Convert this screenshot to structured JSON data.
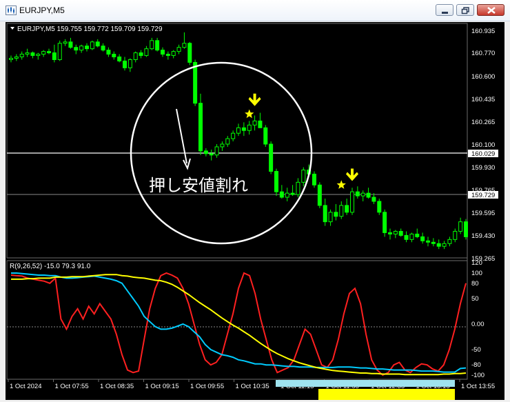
{
  "window": {
    "title": "EURJPY,M5",
    "buttons": [
      "minimize",
      "maximize",
      "close"
    ]
  },
  "chart": {
    "header": "EURJPY,M5  159.755 159.772 159.709 159.729",
    "colors": {
      "background": "#000000",
      "candle": "#00ff00",
      "axis_text": "#ffffff",
      "price_line": "#ffffff",
      "annotation_circle": "#ffffff",
      "arrow": "#ffff00",
      "star": "#ffff00"
    },
    "price_labels": [
      "160.935",
      "160.770",
      "160.600",
      "160.435",
      "160.265",
      "160.100",
      "159.930",
      "159.765",
      "159.595",
      "159.430",
      "159.265"
    ],
    "highlight_labels": [
      "160.029",
      "159.729"
    ],
    "time_labels": [
      "1 Oct 2024",
      "1 Oct 07:55",
      "1 Oct 08:35",
      "1 Oct 09:15",
      "1 Oct 09:55",
      "1 Oct 10:35",
      "1 Oct 11:15",
      "1 Oct 11:55",
      "1 Oct 12:35",
      "1 Oct 13:15",
      "1 Oct 13:55"
    ],
    "annotation": "押し安値割れ"
  },
  "chart_data": [
    {
      "type": "candlestick",
      "symbol": "EURJPY",
      "timeframe": "M5",
      "ylim": [
        159.2,
        161.0
      ],
      "last_price": 159.729,
      "horizontal_line": 160.029,
      "candles": [
        [
          160.72,
          160.75,
          160.7,
          160.73
        ],
        [
          160.73,
          160.76,
          160.71,
          160.74
        ],
        [
          160.74,
          160.78,
          160.72,
          160.76
        ],
        [
          160.76,
          160.8,
          160.74,
          160.77
        ],
        [
          160.77,
          160.78,
          160.73,
          160.75
        ],
        [
          160.75,
          160.77,
          160.72,
          160.76
        ],
        [
          160.76,
          160.79,
          160.74,
          160.78
        ],
        [
          160.78,
          160.8,
          160.76,
          160.77
        ],
        [
          160.77,
          160.83,
          160.7,
          160.72
        ],
        [
          160.72,
          160.86,
          160.71,
          160.84
        ],
        [
          160.84,
          160.87,
          160.82,
          160.85
        ],
        [
          160.85,
          160.88,
          160.8,
          160.81
        ],
        [
          160.81,
          160.83,
          160.76,
          160.79
        ],
        [
          160.79,
          160.83,
          160.77,
          160.82
        ],
        [
          160.82,
          160.84,
          160.78,
          160.8
        ],
        [
          160.8,
          160.86,
          160.79,
          160.85
        ],
        [
          160.85,
          160.87,
          160.81,
          160.82
        ],
        [
          160.82,
          160.84,
          160.78,
          160.79
        ],
        [
          160.79,
          160.81,
          160.74,
          160.76
        ],
        [
          160.76,
          160.78,
          160.72,
          160.74
        ],
        [
          160.74,
          160.76,
          160.7,
          160.71
        ],
        [
          160.71,
          160.74,
          160.64,
          160.66
        ],
        [
          160.66,
          160.73,
          160.63,
          160.72
        ],
        [
          160.72,
          160.78,
          160.7,
          160.77
        ],
        [
          160.77,
          160.79,
          160.73,
          160.75
        ],
        [
          160.75,
          160.82,
          160.74,
          160.8
        ],
        [
          160.8,
          160.88,
          160.79,
          160.86
        ],
        [
          160.86,
          160.88,
          160.78,
          160.79
        ],
        [
          160.79,
          160.81,
          160.74,
          160.76
        ],
        [
          160.76,
          160.78,
          160.72,
          160.75
        ],
        [
          160.75,
          160.79,
          160.73,
          160.78
        ],
        [
          160.78,
          160.83,
          160.76,
          160.81
        ],
        [
          160.81,
          160.92,
          160.8,
          160.84
        ],
        [
          160.84,
          160.85,
          160.68,
          160.7
        ],
        [
          160.7,
          160.72,
          160.38,
          160.4
        ],
        [
          160.4,
          160.47,
          160.02,
          160.05
        ],
        [
          160.05,
          160.07,
          160.01,
          160.03
        ],
        [
          160.03,
          160.06,
          159.98,
          160.02
        ],
        [
          160.02,
          160.1,
          160.0,
          160.08
        ],
        [
          160.08,
          160.12,
          160.05,
          160.1
        ],
        [
          160.1,
          160.16,
          160.08,
          160.14
        ],
        [
          160.14,
          160.2,
          160.12,
          160.18
        ],
        [
          160.18,
          160.25,
          160.16,
          160.22
        ],
        [
          160.22,
          160.26,
          160.16,
          160.2
        ],
        [
          160.2,
          160.27,
          160.17,
          160.24
        ],
        [
          160.24,
          160.31,
          160.2,
          160.27
        ],
        [
          160.27,
          160.33,
          160.22,
          160.22
        ],
        [
          160.22,
          160.24,
          160.08,
          160.1
        ],
        [
          160.1,
          160.12,
          159.88,
          159.9
        ],
        [
          159.9,
          159.92,
          159.72,
          159.75
        ],
        [
          159.75,
          159.8,
          159.7,
          159.71
        ],
        [
          159.71,
          159.78,
          159.68,
          159.74
        ],
        [
          159.74,
          159.8,
          159.72,
          159.73
        ],
        [
          159.73,
          159.85,
          159.71,
          159.82
        ],
        [
          159.82,
          159.93,
          159.79,
          159.91
        ],
        [
          159.91,
          159.95,
          159.86,
          159.88
        ],
        [
          159.88,
          159.9,
          159.78,
          159.8
        ],
        [
          159.8,
          159.82,
          159.63,
          159.65
        ],
        [
          159.65,
          159.7,
          159.5,
          159.53
        ],
        [
          159.53,
          159.62,
          159.5,
          159.6
        ],
        [
          159.6,
          159.66,
          159.54,
          159.57
        ],
        [
          159.57,
          159.68,
          159.55,
          159.65
        ],
        [
          159.65,
          159.7,
          159.58,
          159.6
        ],
        [
          159.6,
          159.78,
          159.58,
          159.75
        ],
        [
          159.75,
          159.79,
          159.7,
          159.72
        ],
        [
          159.72,
          159.76,
          159.68,
          159.74
        ],
        [
          159.74,
          159.78,
          159.7,
          159.71
        ],
        [
          159.71,
          159.74,
          159.66,
          159.68
        ],
        [
          159.68,
          159.7,
          159.58,
          159.6
        ],
        [
          159.6,
          159.62,
          159.42,
          159.45
        ],
        [
          159.45,
          159.48,
          159.4,
          159.44
        ],
        [
          159.44,
          159.47,
          159.41,
          159.46
        ],
        [
          159.46,
          159.48,
          159.42,
          159.43
        ],
        [
          159.43,
          159.46,
          159.38,
          159.4
        ],
        [
          159.4,
          159.45,
          159.38,
          159.44
        ],
        [
          159.44,
          159.48,
          159.41,
          159.42
        ],
        [
          159.42,
          159.45,
          159.37,
          159.39
        ],
        [
          159.39,
          159.42,
          159.35,
          159.38
        ],
        [
          159.38,
          159.41,
          159.35,
          159.37
        ],
        [
          159.37,
          159.4,
          159.33,
          159.35
        ],
        [
          159.35,
          159.39,
          159.33,
          159.37
        ],
        [
          159.37,
          159.42,
          159.35,
          159.4
        ],
        [
          159.4,
          159.48,
          159.38,
          159.46
        ],
        [
          159.46,
          159.56,
          159.44,
          159.53
        ],
        [
          159.53,
          159.55,
          159.4,
          159.42
        ]
      ],
      "markers": [
        {
          "type": "arrow-down",
          "candle": 45,
          "price": 160.42
        },
        {
          "type": "star",
          "candle": 44,
          "price": 160.32
        },
        {
          "type": "arrow-down",
          "candle": 63,
          "price": 159.87
        },
        {
          "type": "star",
          "candle": 61,
          "price": 159.8
        }
      ]
    },
    {
      "type": "line",
      "title": "R(9,26,52) -15.0 79.3 91.0",
      "ylim": [
        -110,
        120
      ],
      "yticks": [
        120,
        100,
        80,
        50,
        0.0,
        -50,
        -80,
        -100
      ],
      "series": [
        {
          "color": "#ff2020",
          "values": [
            96,
            95,
            94,
            90,
            88,
            86,
            84,
            80,
            90,
            10,
            -10,
            15,
            30,
            10,
            35,
            20,
            40,
            25,
            10,
            -20,
            -60,
            -90,
            -95,
            -92,
            -30,
            30,
            70,
            95,
            100,
            96,
            90,
            70,
            40,
            0,
            -40,
            -70,
            -80,
            -75,
            -60,
            -20,
            20,
            70,
            100,
            95,
            60,
            10,
            -30,
            -70,
            -95,
            -90,
            -85,
            -70,
            -40,
            -10,
            -20,
            -50,
            -80,
            -85,
            -70,
            -30,
            20,
            60,
            70,
            40,
            -20,
            -70,
            -90,
            -100,
            -95,
            -80,
            -75,
            -90,
            -95,
            -85,
            -78,
            -80,
            -88,
            -92,
            -80,
            -50,
            -10,
            40,
            80
          ]
        },
        {
          "color": "#00ccff",
          "values": [
            100,
            100,
            99,
            98,
            97,
            96,
            96,
            95,
            95,
            92,
            90,
            90,
            91,
            92,
            93,
            94,
            92,
            90,
            88,
            85,
            80,
            65,
            50,
            35,
            15,
            5,
            -5,
            -10,
            -10,
            -8,
            -4,
            0,
            -5,
            -15,
            -25,
            -40,
            -50,
            -55,
            -60,
            -62,
            -65,
            -70,
            -72,
            -75,
            -78,
            -78,
            -80,
            -80,
            -81,
            -82,
            -83,
            -83,
            -84,
            -84,
            -84,
            -85,
            -85,
            -85,
            -85,
            -84,
            -84,
            -84,
            -85,
            -86,
            -86,
            -87,
            -88,
            -88,
            -89,
            -90,
            -90,
            -90,
            -90,
            -91,
            -92,
            -92,
            -92,
            -93,
            -94,
            -94,
            -94,
            -87,
            -86
          ]
        },
        {
          "color": "#ffff00",
          "values": [
            88,
            88,
            88,
            89,
            89,
            90,
            90,
            90,
            92,
            92,
            92,
            93,
            93,
            93,
            94,
            95,
            96,
            97,
            97,
            97,
            95,
            94,
            92,
            91,
            90,
            88,
            86,
            85,
            82,
            78,
            72,
            65,
            58,
            50,
            42,
            35,
            28,
            20,
            12,
            5,
            -2,
            -8,
            -15,
            -22,
            -30,
            -38,
            -45,
            -52,
            -58,
            -63,
            -68,
            -72,
            -76,
            -79,
            -82,
            -85,
            -87,
            -89,
            -91,
            -92,
            -93,
            -94,
            -95,
            -96,
            -96,
            -97,
            -97,
            -98,
            -98,
            -98,
            -98,
            -99,
            -99,
            -99,
            -99,
            -99,
            -99,
            -99,
            -98,
            -98,
            -97,
            -97,
            -96
          ]
        }
      ],
      "horizontal_line": 0
    }
  ]
}
